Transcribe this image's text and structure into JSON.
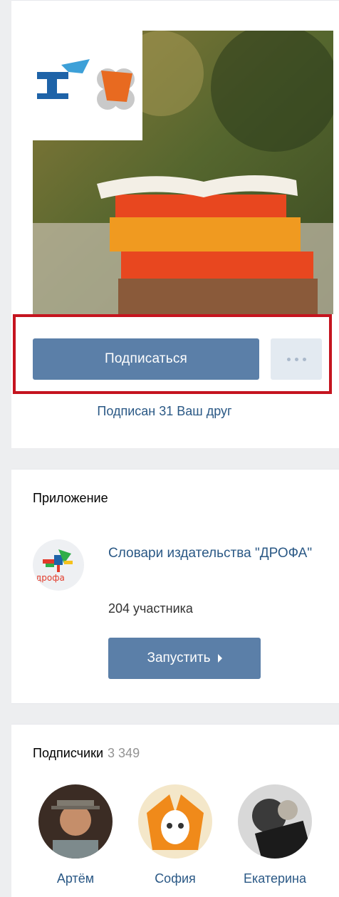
{
  "community": {
    "subscribe_label": "Подписаться",
    "friends_text": "Подписан 31 Ваш друг"
  },
  "app": {
    "section_title": "Приложение",
    "name": "Словари издательства \"ДРОФА\"",
    "members": "204 участника",
    "launch_label": "Запустить"
  },
  "subscribers": {
    "section_title": "Подписчики",
    "count": "3 349",
    "items": [
      {
        "name": "Артём"
      },
      {
        "name": "София"
      },
      {
        "name": "Екатерина"
      }
    ]
  },
  "colors": {
    "accent": "#5b7fa8",
    "link": "#2a5885",
    "highlight_border": "#c5141f"
  }
}
